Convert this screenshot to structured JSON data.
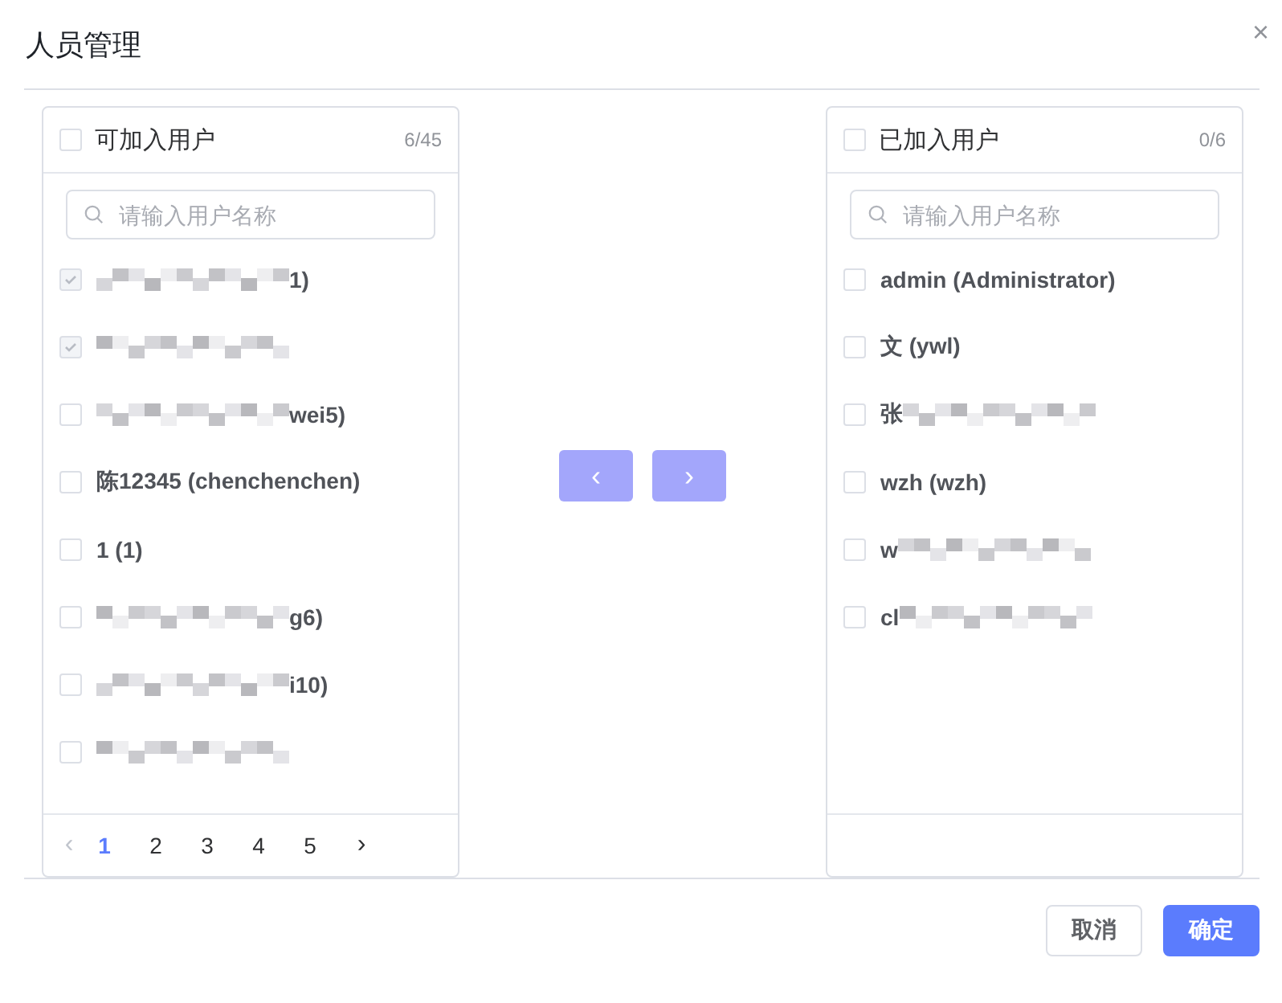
{
  "dialog": {
    "title": "人员管理",
    "close": "×"
  },
  "source": {
    "title": "可加入用户",
    "count": "6/45",
    "checked": false,
    "search": {
      "placeholder": "请输入用户名称"
    },
    "items": [
      {
        "kind": "masked",
        "suffix": "1)",
        "checked": true,
        "disabled": true
      },
      {
        "kind": "masked",
        "checked": true,
        "disabled": true
      },
      {
        "kind": "masked",
        "suffix": "wei5)",
        "checked": false,
        "disabled": false
      },
      {
        "kind": "plain",
        "label": "陈12345 (chenchenchen)",
        "checked": false,
        "disabled": false
      },
      {
        "kind": "plain",
        "label": "1 (1)",
        "checked": false,
        "disabled": false
      },
      {
        "kind": "masked",
        "suffix": "g6)",
        "checked": false,
        "disabled": false
      },
      {
        "kind": "masked",
        "suffix": "i10)",
        "checked": false,
        "disabled": false
      },
      {
        "kind": "masked",
        "checked": false,
        "disabled": false
      }
    ],
    "pagination": {
      "prev": "‹",
      "next": "›",
      "prev_disabled": true,
      "pages": [
        {
          "label": "1",
          "selected": true
        },
        {
          "label": "2",
          "selected": false
        },
        {
          "label": "3",
          "selected": false
        },
        {
          "label": "4",
          "selected": false
        },
        {
          "label": "5",
          "selected": false
        }
      ]
    }
  },
  "transfer": [
    {
      "label": "‹",
      "disabled": true
    },
    {
      "label": "›",
      "disabled": true
    }
  ],
  "target": {
    "title": "已加入用户",
    "count": "0/6",
    "checked": false,
    "search": {
      "placeholder": "请输入用户名称"
    },
    "items": [
      {
        "kind": "plain",
        "label": "admin (Administrator)",
        "checked": false,
        "disabled": false
      },
      {
        "kind": "plain",
        "label": "文 (ywl)",
        "checked": false,
        "disabled": false
      },
      {
        "kind": "masked",
        "prefix": "张",
        "checked": false,
        "disabled": false
      },
      {
        "kind": "plain",
        "label": "wzh (wzh)",
        "checked": false,
        "disabled": false
      },
      {
        "kind": "masked",
        "prefix": "w",
        "checked": false,
        "disabled": false
      },
      {
        "kind": "masked",
        "prefix": "cl",
        "checked": false,
        "disabled": false
      }
    ]
  },
  "buttons": [
    {
      "label": "取消",
      "kind": "secondary"
    },
    {
      "label": "确定",
      "kind": "primary"
    }
  ]
}
